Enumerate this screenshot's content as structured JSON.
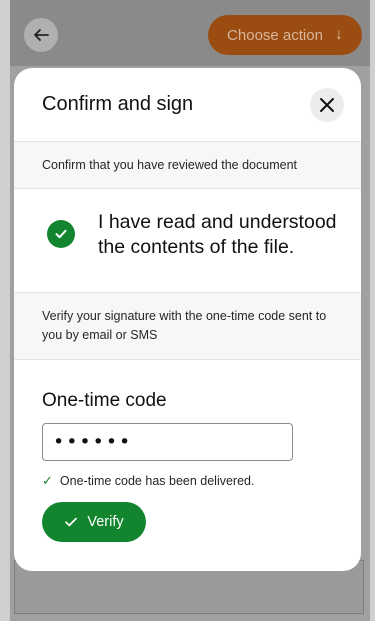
{
  "topbar": {
    "back_icon": "arrow-left-icon",
    "action_label": "Choose action",
    "action_arrow": "↓",
    "action_color": "#9a4c11"
  },
  "modal": {
    "title": "Confirm and sign",
    "close_icon": "close-icon",
    "review_note": "Confirm that you have reviewed the document",
    "confirm_text": "I have read and understood the contents of the file.",
    "verify_note": "Verify your signature with the one-time code sent to you by email or SMS",
    "code_label": "One-time code",
    "code_value": "••••••",
    "delivered_text": "One-time code has been delivered.",
    "verify_label": "Verify",
    "accent_color": "#14852f"
  }
}
